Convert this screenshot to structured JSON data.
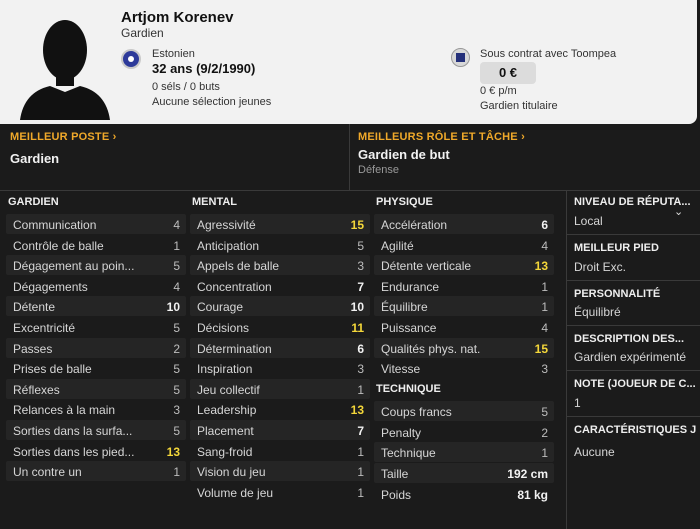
{
  "player": {
    "name": "Artjom Korenev",
    "position": "Gardien",
    "nationality": "Estonien",
    "age": "32 ans (9/2/1990)",
    "caps": "0 séls / 0 buts",
    "youth": "Aucune sélection jeunes",
    "contract": "Sous contrat avec Toompea",
    "wage": "0 €",
    "wage_pm": "0 € p/m",
    "status": "Gardien titulaire"
  },
  "best_position": {
    "title": "MEILLEUR POSTE ›",
    "value": "Gardien"
  },
  "best_role": {
    "title": "MEILLEURS RÔLE ET TÂCHE ›",
    "value": "Gardien de but",
    "sub": "Défense"
  },
  "goalkeeping": {
    "title": "GARDIEN",
    "rows": [
      {
        "label": "Communication",
        "value": "4"
      },
      {
        "label": "Contrôle de balle",
        "value": "1"
      },
      {
        "label": "Dégagement au poin...",
        "value": "5"
      },
      {
        "label": "Dégagements",
        "value": "4"
      },
      {
        "label": "Détente",
        "value": "10"
      },
      {
        "label": "Excentricité",
        "value": "5"
      },
      {
        "label": "Passes",
        "value": "2"
      },
      {
        "label": "Prises de balle",
        "value": "5"
      },
      {
        "label": "Réflexes",
        "value": "5"
      },
      {
        "label": "Relances à la main",
        "value": "3"
      },
      {
        "label": "Sorties dans la surfa...",
        "value": "5"
      },
      {
        "label": "Sorties dans les pied...",
        "value": "13"
      },
      {
        "label": "Un contre un",
        "value": "1"
      }
    ]
  },
  "mental": {
    "title": "MENTAL",
    "rows": [
      {
        "label": "Agressivité",
        "value": "15"
      },
      {
        "label": "Anticipation",
        "value": "5"
      },
      {
        "label": "Appels de balle",
        "value": "3"
      },
      {
        "label": "Concentration",
        "value": "7"
      },
      {
        "label": "Courage",
        "value": "10"
      },
      {
        "label": "Décisions",
        "value": "11"
      },
      {
        "label": "Détermination",
        "value": "6"
      },
      {
        "label": "Inspiration",
        "value": "3"
      },
      {
        "label": "Jeu collectif",
        "value": "1"
      },
      {
        "label": "Leadership",
        "value": "13"
      },
      {
        "label": "Placement",
        "value": "7"
      },
      {
        "label": "Sang-froid",
        "value": "1"
      },
      {
        "label": "Vision du jeu",
        "value": "1"
      },
      {
        "label": "Volume de jeu",
        "value": "1"
      }
    ]
  },
  "physical": {
    "title": "PHYSIQUE",
    "rows": [
      {
        "label": "Accélération",
        "value": "6"
      },
      {
        "label": "Agilité",
        "value": "4"
      },
      {
        "label": "Détente verticale",
        "value": "13"
      },
      {
        "label": "Endurance",
        "value": "1"
      },
      {
        "label": "Équilibre",
        "value": "1"
      },
      {
        "label": "Puissance",
        "value": "4"
      },
      {
        "label": "Qualités phys. nat.",
        "value": "15"
      },
      {
        "label": "Vitesse",
        "value": "3"
      }
    ]
  },
  "technical": {
    "title": "TECHNIQUE",
    "rows": [
      {
        "label": "Coups francs",
        "value": "5"
      },
      {
        "label": "Penalty",
        "value": "2"
      },
      {
        "label": "Technique",
        "value": "1"
      }
    ]
  },
  "body": {
    "height_label": "Taille",
    "height": "192 cm",
    "weight_label": "Poids",
    "weight": "81 kg"
  },
  "side": {
    "reputation_title": "NIVEAU DE RÉPUTA...",
    "reputation": "Local",
    "foot_title": "MEILLEUR PIED",
    "foot": "Droit Exc.",
    "personality_title": "PERSONNALITÉ",
    "personality": "Équilibré",
    "description_title": "DESCRIPTION DES...",
    "description": "Gardien expérimenté",
    "note_title": "NOTE (JOUEUR DE C...",
    "note": "1",
    "traits_title": "CARACTÉRISTIQUES J",
    "traits": "Aucune"
  }
}
